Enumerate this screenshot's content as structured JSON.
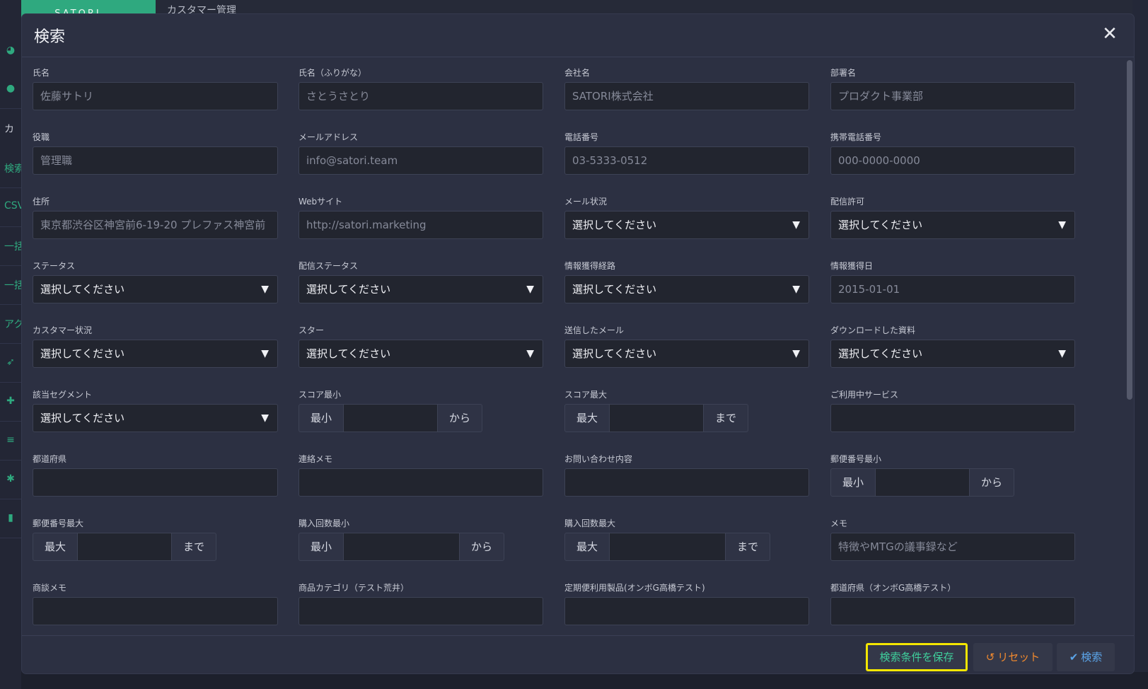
{
  "app": {
    "brand": "SATORI",
    "header_title": "カスタマー管理",
    "sidebar_texts": [
      "カ",
      "検索",
      "CSV",
      "一括",
      "一括",
      "アク"
    ]
  },
  "modal": {
    "title": "検索",
    "close": "✕"
  },
  "fields": {
    "name": {
      "label": "氏名",
      "placeholder": "佐藤サトリ"
    },
    "kana": {
      "label": "氏名（ふりがな）",
      "placeholder": "さとうさとり"
    },
    "company": {
      "label": "会社名",
      "placeholder": "SATORI株式会社"
    },
    "department": {
      "label": "部署名",
      "placeholder": "プロダクト事業部"
    },
    "position": {
      "label": "役職",
      "placeholder": "管理職"
    },
    "email": {
      "label": "メールアドレス",
      "placeholder": "info@satori.team"
    },
    "phone": {
      "label": "電話番号",
      "placeholder": "03-5333-0512"
    },
    "mobile": {
      "label": "携帯電話番号",
      "placeholder": "000-0000-0000"
    },
    "address": {
      "label": "住所",
      "placeholder": "東京都渋谷区神宮前6-19-20 プレファス神宮前"
    },
    "website": {
      "label": "Webサイト",
      "placeholder": "http://satori.marketing"
    },
    "mail_status": {
      "label": "メール状況",
      "value": "選択してください"
    },
    "delivery_permission": {
      "label": "配信許可",
      "value": "選択してください"
    },
    "status": {
      "label": "ステータス",
      "value": "選択してください"
    },
    "delivery_status": {
      "label": "配信ステータス",
      "value": "選択してください"
    },
    "acquisition_route": {
      "label": "情報獲得経路",
      "value": "選択してください"
    },
    "acquisition_date": {
      "label": "情報獲得日",
      "placeholder": "2015-01-01"
    },
    "customer_status": {
      "label": "カスタマー状況",
      "value": "選択してください"
    },
    "star": {
      "label": "スター",
      "value": "選択してください"
    },
    "sent_mail": {
      "label": "送信したメール",
      "value": "選択してください"
    },
    "downloaded_docs": {
      "label": "ダウンロードした資料",
      "value": "選択してください"
    },
    "segment": {
      "label": "該当セグメント",
      "value": "選択してください"
    },
    "score_min": {
      "label": "スコア最小",
      "prefix": "最小",
      "suffix": "から"
    },
    "score_max": {
      "label": "スコア最大",
      "prefix": "最大",
      "suffix": "まで"
    },
    "services": {
      "label": "ご利用中サービス"
    },
    "prefecture": {
      "label": "都道府県"
    },
    "contact_memo": {
      "label": "連絡メモ"
    },
    "inquiry": {
      "label": "お問い合わせ内容"
    },
    "zip_min": {
      "label": "郵便番号最小",
      "prefix": "最小",
      "suffix": "から"
    },
    "zip_max": {
      "label": "郵便番号最大",
      "prefix": "最大",
      "suffix": "まで"
    },
    "purchase_min": {
      "label": "購入回数最小",
      "prefix": "最小",
      "suffix": "から"
    },
    "purchase_max": {
      "label": "購入回数最大",
      "prefix": "最大",
      "suffix": "まで"
    },
    "memo": {
      "label": "メモ",
      "placeholder": "特徴やMTGの議事録など"
    },
    "deal_memo": {
      "label": "商談メモ"
    },
    "product_category": {
      "label": "商品カテゴリ（テスト荒井）"
    },
    "subscription_product": {
      "label": "定期便利用製品(オンボG高橋テスト)"
    },
    "prefecture_test": {
      "label": "都道府県（オンボG高橋テスト）"
    }
  },
  "footer": {
    "save_label": "検索条件を保存",
    "reset_label": "リセット",
    "search_label": "検索",
    "reset_icon": "↺",
    "search_icon": "✔"
  },
  "colors": {
    "brand": "#2fa97f",
    "save_text": "#3fcf9c",
    "reset_text": "#f0892e",
    "search_text": "#5ba4e8",
    "highlight": "#f3e600"
  }
}
